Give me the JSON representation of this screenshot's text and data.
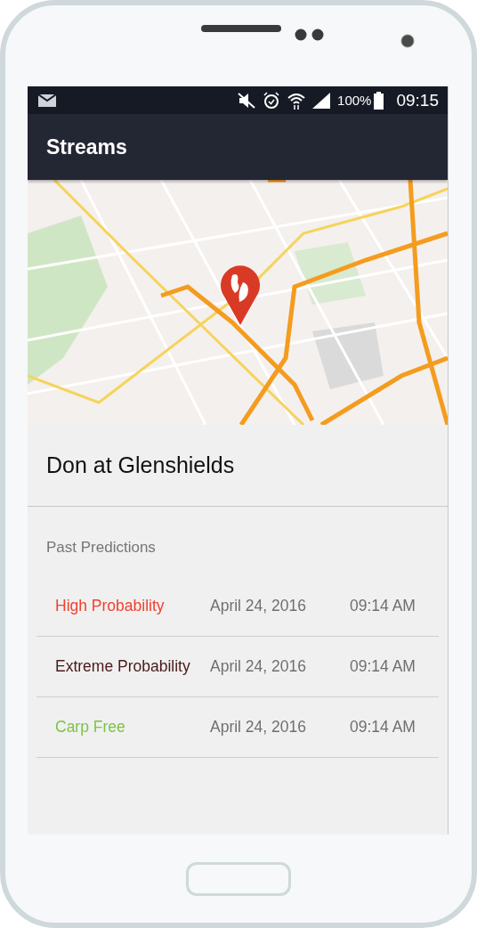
{
  "status_bar": {
    "battery": "100%",
    "time": "09:15"
  },
  "app_bar": {
    "title": "Streams"
  },
  "stream": {
    "name": "Don at Glenshields"
  },
  "section_title": "Past Predictions",
  "predictions": [
    {
      "label": "High Probability",
      "color": "#f0412f",
      "date": "April 24, 2016",
      "time": "09:14 AM"
    },
    {
      "label": "Extreme Probability",
      "color": "#4a1a1a",
      "date": "April 24, 2016",
      "time": "09:14 AM"
    },
    {
      "label": "Carp Free",
      "color": "#7cc444",
      "date": "April 24, 2016",
      "time": "09:14 AM"
    }
  ]
}
